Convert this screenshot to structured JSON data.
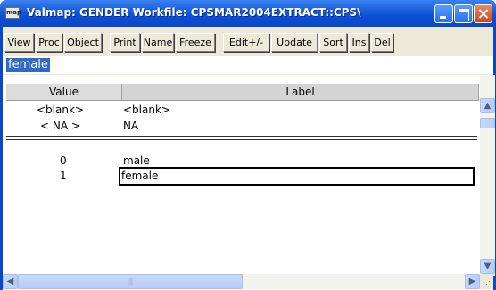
{
  "window": {
    "app_icon": "map",
    "title": "Valmap: GENDER   Workfile: CPSMAR2004EXTRACT::CPS\\"
  },
  "toolbar": {
    "buttons": [
      "View",
      "Proc",
      "Object",
      "Print",
      "Name",
      "Freeze",
      "Edit+/-",
      "Update",
      "Sort",
      "Ins",
      "Del"
    ]
  },
  "edit_field": {
    "value": "female"
  },
  "grid": {
    "headers": {
      "value": "Value",
      "label": "Label"
    },
    "special_rows": [
      {
        "value": "<blank>",
        "label": "<blank>"
      },
      {
        "value": "< NA >",
        "label": "NA"
      }
    ],
    "rows": [
      {
        "value": "0",
        "label": "male"
      },
      {
        "value": "1",
        "label": "female"
      }
    ],
    "selected_row": 1
  },
  "icons": {
    "scroll_up": "chevron-up-icon",
    "scroll_down": "chevron-down-icon",
    "scroll_left": "chevron-left-icon",
    "scroll_right": "chevron-right-icon",
    "grip": "resize-grip-icon"
  },
  "colors": {
    "titlebar": "#0a48c6",
    "selection": "#316ac5",
    "close_button": "#c9461d"
  }
}
